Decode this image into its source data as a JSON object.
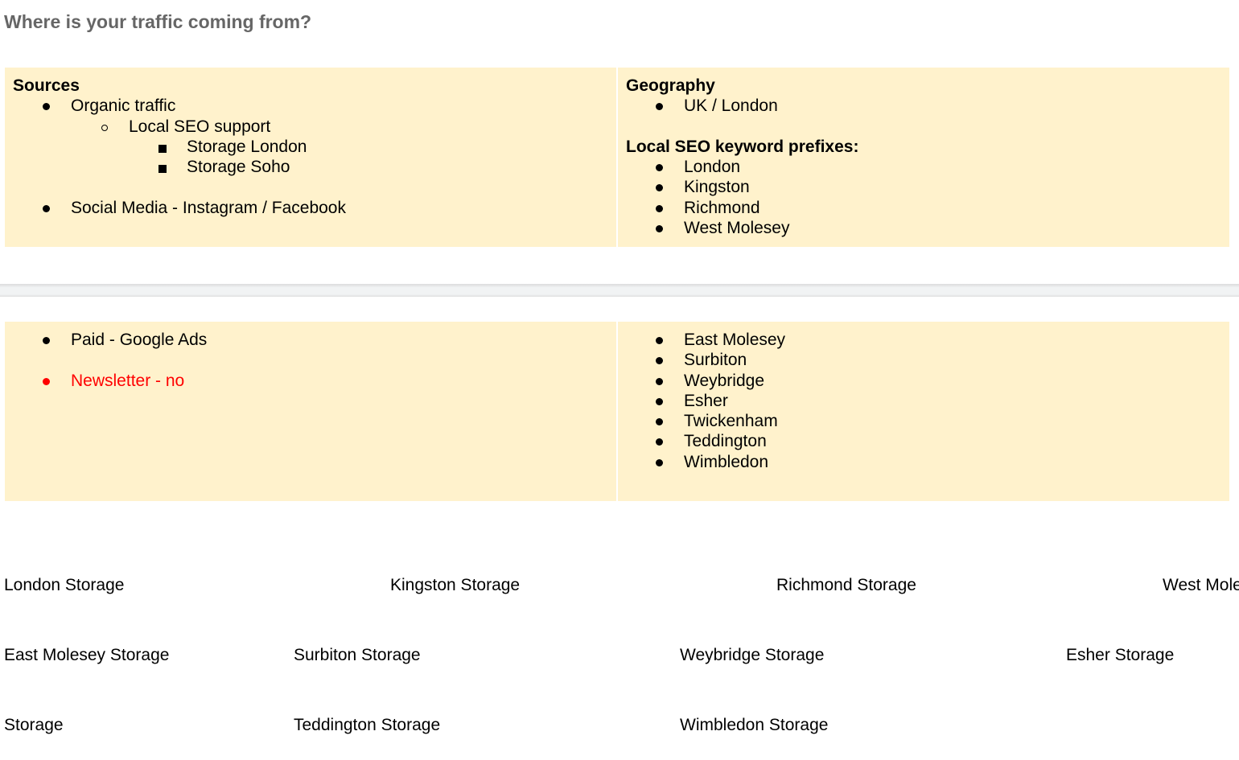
{
  "heading": "Where is your traffic coming from?",
  "table_top": {
    "left": {
      "title": "Sources",
      "items": [
        {
          "level": 0,
          "bullet": "disc",
          "text": "Organic traffic"
        },
        {
          "level": 1,
          "bullet": "circle",
          "text": "Local SEO support"
        },
        {
          "level": 2,
          "bullet": "square",
          "text": "Storage London"
        },
        {
          "level": 2,
          "bullet": "square",
          "text": "Storage Soho"
        },
        {
          "level": 0,
          "bullet": "disc",
          "text": "Social Media - Instagram / Facebook"
        }
      ]
    },
    "right": {
      "title": "Geography",
      "geo_items": [
        "UK / London"
      ],
      "subtitle": "Local SEO keyword prefixes:",
      "prefix_items": [
        "London",
        "Kingston",
        "Richmond",
        "West Molesey"
      ]
    }
  },
  "table_bottom": {
    "left": {
      "items": [
        {
          "text": "Paid - Google Ads",
          "color": "#000000"
        },
        {
          "text": "Newsletter - no",
          "color": "#ff0000"
        }
      ]
    },
    "right": {
      "prefix_items": [
        "East Molesey",
        "Surbiton",
        "Weybridge",
        "Esher",
        "Twickenham",
        "Teddington",
        "Wimbledon"
      ]
    }
  },
  "keywords_text": {
    "line1": "London Storage\t\t\tKingston Storage\t\t\tRichmond Storage\t\t\tWest Molesey Storage",
    "line2": "East Molesey Storage\t\tSurbiton Storage\t\t\tWeybridge Storage\t\t\tEsher Storage\t\t\tTwickenham",
    "line3": "Storage\t\t\tTeddington Storage\t\t\tWimbledon Storage"
  },
  "colors": {
    "cell_background": "#fff2cc",
    "heading": "#666666",
    "warning_text": "#ff0000"
  }
}
